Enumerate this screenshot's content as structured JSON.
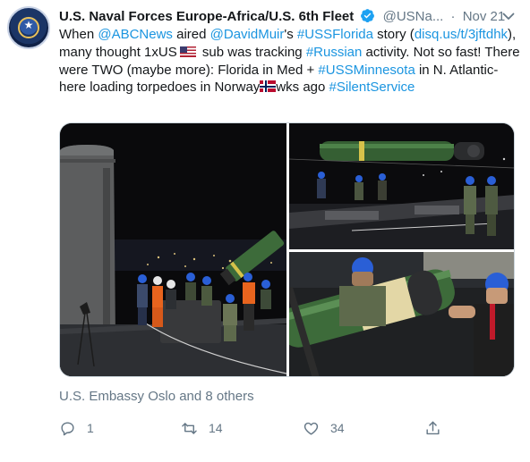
{
  "tweet": {
    "author_name": "U.S. Naval Forces Europe-Africa/U.S. 6th Fleet",
    "handle": "@USNa...",
    "separator": "·",
    "date": "Nov 21",
    "text_parts": [
      {
        "t": "When ",
        "link": false
      },
      {
        "t": "@ABCNews",
        "link": true
      },
      {
        "t": " aired ",
        "link": false
      },
      {
        "t": "@DavidMuir",
        "link": true
      },
      {
        "t": "'s ",
        "link": false
      },
      {
        "t": "#USSFlorida",
        "link": true
      },
      {
        "t": " story (",
        "link": false
      },
      {
        "t": "disq.us/t/3jftdhk",
        "link": true
      },
      {
        "t": "), many thought 1xUS",
        "link": false
      },
      {
        "flag": "us"
      },
      {
        "t": " sub was tracking ",
        "link": false
      },
      {
        "t": "#Russian",
        "link": true
      },
      {
        "t": " activity. Not so fast! There were TWO (maybe more): Florida in Med + ",
        "link": false
      },
      {
        "t": "#USSMinnesota",
        "link": true
      },
      {
        "t": " in N. Atlantic-here loading torpedoes in Norway",
        "link": false
      },
      {
        "flag": "no"
      },
      {
        "t": "wks ago ",
        "link": false
      },
      {
        "t": "#SilentService",
        "link": true
      }
    ],
    "liked_by": "U.S. Embassy Oslo and 8 others",
    "actions": {
      "reply_icon": "reply-icon",
      "reply_count": "1",
      "retweet_icon": "retweet-icon",
      "retweet_count": "14",
      "like_icon": "heart-icon",
      "like_count": "34",
      "share_icon": "share-icon"
    }
  },
  "colors": {
    "link": "#1b95e0",
    "secondary_text": "#657786",
    "primary_text": "#14171a",
    "verified": "#1da1f2",
    "torpedo_green": "#3d6b3a",
    "safety_orange": "#e8641e",
    "hardhat_blue": "#2a5fd6"
  }
}
